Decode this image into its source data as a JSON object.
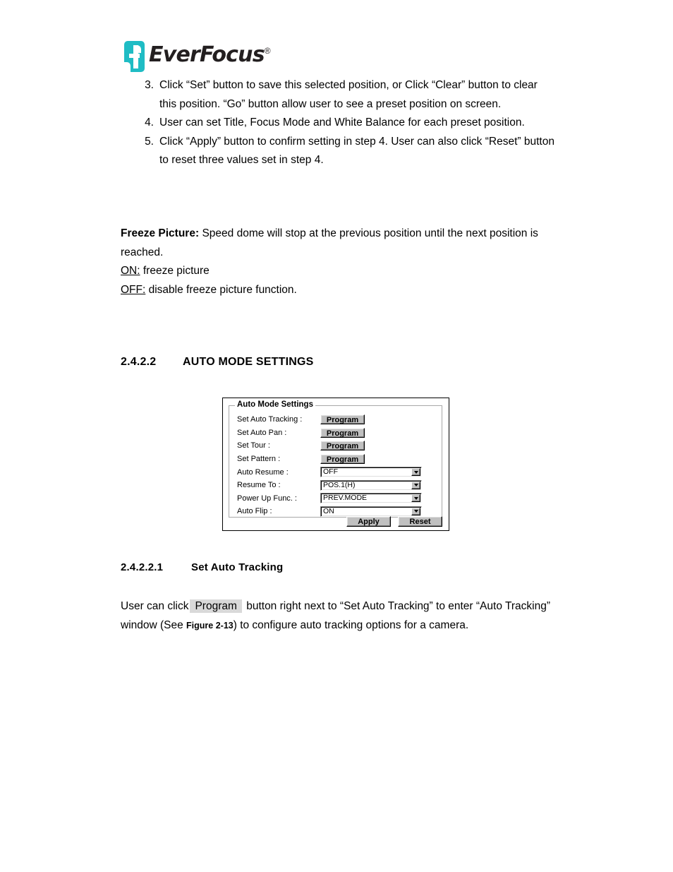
{
  "brand": {
    "logo_icon": "everfocus-f-logo",
    "wordmark": "EverFocus",
    "registered_mark": "®",
    "logo_color": "#1fbcc4"
  },
  "numbered_list": [
    {
      "num": "3.",
      "text": "Click “Set” button to save this selected position, or Click “Clear” button to clear this position. “Go” button allow user to see a preset position on screen."
    },
    {
      "num": "4.",
      "text": "User can set Title, Focus Mode and White Balance for each preset position."
    },
    {
      "num": "5.",
      "text": "Click “Apply” button to confirm setting in step 4. User can also click “Reset” button to reset three values set in step 4."
    }
  ],
  "freeze_picture": {
    "lead": "Freeze Picture:",
    "description": " Speed dome will stop at the previous position until the next position is reached.",
    "on_label": "ON:",
    "on_text": " freeze picture",
    "off_label": "OFF:",
    "off_text": " disable freeze picture function."
  },
  "headings": {
    "auto_mode_number": "2.4.2.2",
    "auto_mode_title": "AUTO MODE SETTINGS",
    "set_auto_tracking_number": "2.4.2.2.1",
    "set_auto_tracking_title": "Set Auto Tracking"
  },
  "dialog": {
    "legend": "Auto Mode Settings",
    "rows": [
      {
        "label": "Set Auto Tracking :",
        "control": "button",
        "value": "Program"
      },
      {
        "label": "Set Auto Pan  :",
        "control": "button",
        "value": "Program"
      },
      {
        "label": "Set Tour :",
        "control": "button",
        "value": "Program"
      },
      {
        "label": "Set Pattern :",
        "control": "button",
        "value": "Program"
      },
      {
        "label": "Auto Resume :",
        "control": "combo",
        "value": "OFF"
      },
      {
        "label": "Resume To :",
        "control": "combo",
        "value": "POS.1(H)"
      },
      {
        "label": "Power Up Func. :",
        "control": "combo",
        "value": "PREV.MODE"
      },
      {
        "label": "Auto Flip :",
        "control": "combo",
        "value": "ON"
      }
    ],
    "apply_label": "Apply",
    "reset_label": "Reset",
    "dropdown_icon": "chevron-down-icon"
  },
  "closing_paragraph": {
    "part1": "User can click",
    "chip": "Program",
    "part2": " button right next to “Set Auto Tracking” to enter “Auto Tracking” window (See ",
    "figure_ref": "Figure 2-13",
    "part3": ") to configure auto tracking options for a camera."
  }
}
